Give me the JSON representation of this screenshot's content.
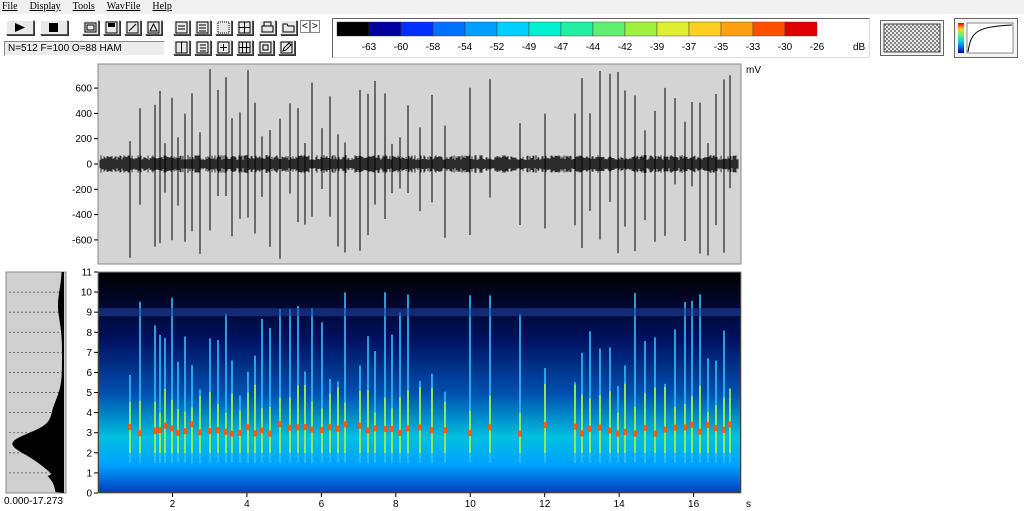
{
  "menu": [
    "File",
    "Display",
    "Tools",
    "WavFile",
    "Help"
  ],
  "toolbar": {
    "play": "play-icon",
    "stop": "stop-icon",
    "row1_icons": [
      "window-icon",
      "save-icon",
      "edit-icon",
      "triangle-icon",
      "doc-icon",
      "grid-doc-icon",
      "dots-icon",
      "grid-icon",
      "print-icon",
      "open-icon"
    ],
    "row2_icons": [
      "split-icon",
      "list-icon",
      "cross-icon",
      "grid-icon",
      "frame-icon",
      "pencil-icon"
    ],
    "nav": [
      "<",
      ">"
    ]
  },
  "status_text": "N=512 F=100 O=88 HAM",
  "colorbar": {
    "unit": "dB",
    "labels": [
      "-63",
      "-60",
      "-58",
      "-54",
      "-52",
      "-49",
      "-47",
      "-44",
      "-42",
      "-39",
      "-37",
      "-35",
      "-33",
      "-30",
      "-26"
    ],
    "colors": [
      "#000000",
      "#0000a0",
      "#0030ff",
      "#0070ff",
      "#00a0ff",
      "#00d0ff",
      "#00f0d0",
      "#20f0a0",
      "#60f070",
      "#a0f040",
      "#e0f030",
      "#ffd020",
      "#ffa010",
      "#ff5000",
      "#e00000"
    ]
  },
  "waveform": {
    "unit": "mV",
    "y_ticks": [
      "600",
      "400",
      "200",
      "0",
      "-200",
      "-400",
      "-600"
    ]
  },
  "spectrogram": {
    "y_ticks": [
      "11",
      "10",
      "9",
      "8",
      "7",
      "6",
      "5",
      "4",
      "3",
      "2",
      "1",
      "0"
    ],
    "x_ticks": [
      "2",
      "4",
      "6",
      "8",
      "10",
      "12",
      "14",
      "16"
    ],
    "x_unit": "s"
  },
  "range_label": "0.000-17.273"
}
